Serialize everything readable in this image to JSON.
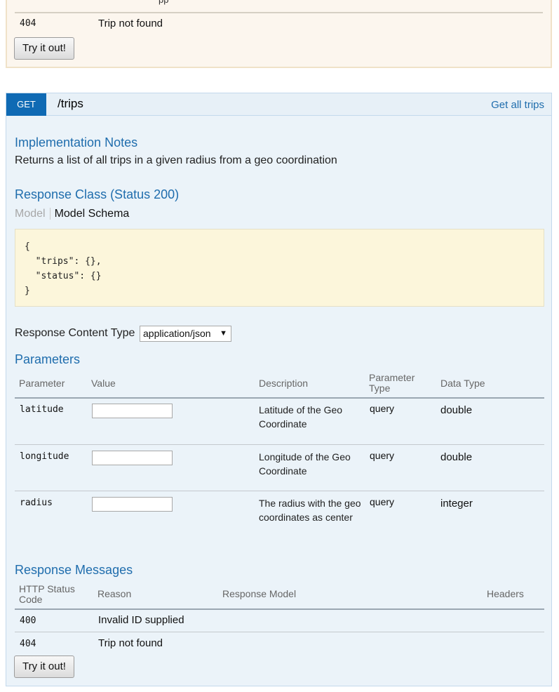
{
  "prev_operation": {
    "cut_text": "pp",
    "responses": [
      {
        "code": "404",
        "reason": "Trip not found"
      }
    ],
    "try_label": "Try it out!"
  },
  "operation": {
    "method": "GET",
    "path": "/trips",
    "summary": "Get all trips",
    "impl_notes_title": "Implementation Notes",
    "impl_notes": "Returns a list of all trips in a given radius from a geo coordination",
    "response_class_title": "Response Class (Status 200)",
    "model_tab": "Model",
    "schema_tab": "Model Schema",
    "schema": "{\n  \"trips\": {},\n  \"status\": {}\n}",
    "content_type_label": "Response Content Type",
    "content_type_value": "application/json",
    "parameters_title": "Parameters",
    "param_headers": {
      "parameter": "Parameter",
      "value": "Value",
      "description": "Description",
      "parameter_type": "Parameter Type",
      "data_type": "Data Type"
    },
    "parameters": [
      {
        "name": "latitude",
        "value": "",
        "description": "Latitude of the Geo Coordinate",
        "param_type": "query",
        "data_type": "double"
      },
      {
        "name": "longitude",
        "value": "",
        "description": "Longitude of the Geo Coordinate",
        "param_type": "query",
        "data_type": "double"
      },
      {
        "name": "radius",
        "value": "",
        "description": "The radius with the geo coordinates as center",
        "param_type": "query",
        "data_type": "integer"
      }
    ],
    "response_messages_title": "Response Messages",
    "resp_headers": {
      "status_code": "HTTP Status Code",
      "reason": "Reason",
      "model": "Response Model",
      "headers": "Headers"
    },
    "responses": [
      {
        "code": "400",
        "reason": "Invalid ID supplied"
      },
      {
        "code": "404",
        "reason": "Trip not found"
      }
    ],
    "try_label": "Try it out!"
  },
  "colors": {
    "get_method": "#0f6ab4",
    "heading_link": "#1f6dad",
    "op_background": "#ebf3f9",
    "prev_op_background": "#fcf6ee",
    "schema_background": "#fcf6db"
  }
}
